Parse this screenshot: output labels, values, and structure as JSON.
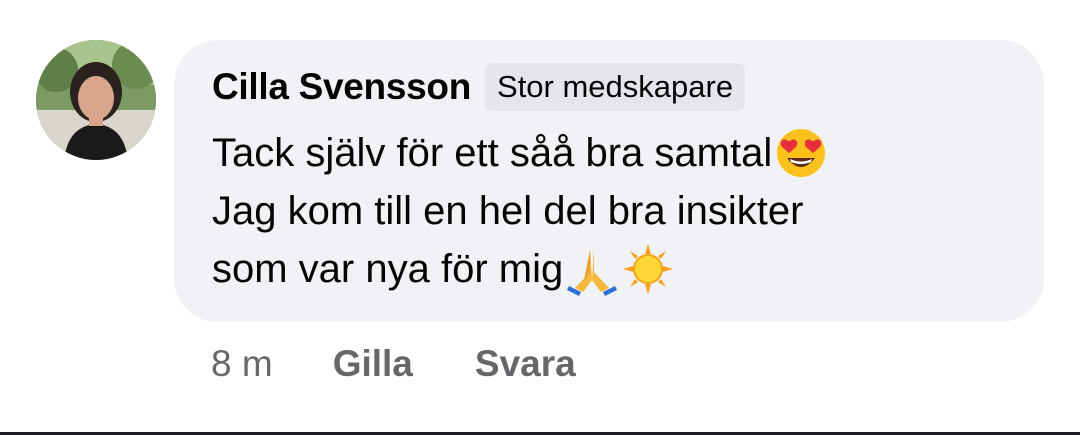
{
  "comment": {
    "author": "Cilla Svensson",
    "badge": "Stor medskapare",
    "lines": [
      "Tack själv för ett såå bra samtal",
      "Jag kom till en hel del bra insikter",
      "som var nya för mig"
    ],
    "emojis": [
      "heart-eyes-emoji",
      "folded-hands-emoji",
      "sun-emoji"
    ]
  },
  "actions": {
    "timestamp": "8 m",
    "like_label": "Gilla",
    "reply_label": "Svara"
  }
}
